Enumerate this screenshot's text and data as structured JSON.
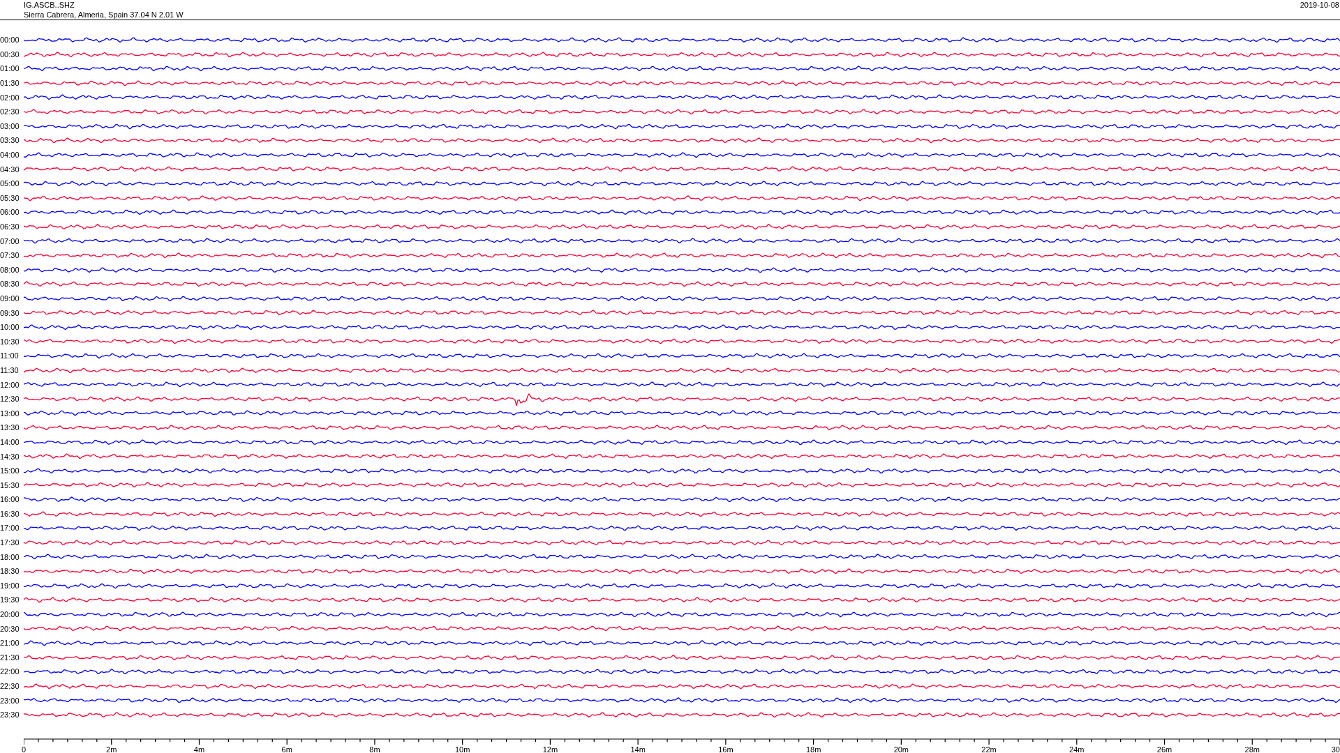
{
  "header": {
    "station": "IG.ASCB..SHZ",
    "location": "Sierra Cabrera, Almeria, Spain  37.04 N 2.01 W",
    "date": "2019-10-08"
  },
  "traces": [
    {
      "label": "00:00",
      "color": "#0000ff"
    },
    {
      "label": "00:30",
      "color": "#ff0033"
    },
    {
      "label": "01:00",
      "color": "#0000ff"
    },
    {
      "label": "01:30",
      "color": "#ff0033"
    },
    {
      "label": "02:00",
      "color": "#0000ff"
    },
    {
      "label": "02:30",
      "color": "#ff0033"
    },
    {
      "label": "03:00",
      "color": "#0000ff"
    },
    {
      "label": "03:30",
      "color": "#ff0033"
    },
    {
      "label": "04:00",
      "color": "#0000ff"
    },
    {
      "label": "04:30",
      "color": "#ff0033"
    },
    {
      "label": "05:00",
      "color": "#0000ff"
    },
    {
      "label": "05:30",
      "color": "#ff0033"
    },
    {
      "label": "06:00",
      "color": "#0000ff"
    },
    {
      "label": "06:30",
      "color": "#ff0033"
    },
    {
      "label": "07:00",
      "color": "#0000ff"
    },
    {
      "label": "07:30",
      "color": "#ff0033"
    },
    {
      "label": "08:00",
      "color": "#0000ff"
    },
    {
      "label": "08:30",
      "color": "#ff0033"
    },
    {
      "label": "09:00",
      "color": "#0000ff"
    },
    {
      "label": "09:30",
      "color": "#ff0033"
    },
    {
      "label": "10:00",
      "color": "#0000ff"
    },
    {
      "label": "10:30",
      "color": "#ff0033"
    },
    {
      "label": "11:00",
      "color": "#0000ff"
    },
    {
      "label": "11:30",
      "color": "#ff0033"
    },
    {
      "label": "12:00",
      "color": "#0000ff"
    },
    {
      "label": "12:30",
      "color": "#ff0033"
    },
    {
      "label": "13:00",
      "color": "#0000ff"
    },
    {
      "label": "13:30",
      "color": "#ff0033"
    },
    {
      "label": "14:00",
      "color": "#0000ff"
    },
    {
      "label": "14:30",
      "color": "#ff0033"
    },
    {
      "label": "15:00",
      "color": "#0000ff"
    },
    {
      "label": "15:30",
      "color": "#ff0033"
    },
    {
      "label": "16:00",
      "color": "#0000ff"
    },
    {
      "label": "16:30",
      "color": "#ff0033"
    },
    {
      "label": "17:00",
      "color": "#0000ff"
    },
    {
      "label": "17:30",
      "color": "#ff0033"
    },
    {
      "label": "18:00",
      "color": "#0000ff"
    },
    {
      "label": "18:30",
      "color": "#ff0033"
    },
    {
      "label": "19:00",
      "color": "#0000ff"
    },
    {
      "label": "19:30",
      "color": "#ff0033"
    },
    {
      "label": "20:00",
      "color": "#0000ff"
    },
    {
      "label": "20:30",
      "color": "#ff0033"
    },
    {
      "label": "21:00",
      "color": "#0000ff"
    },
    {
      "label": "21:30",
      "color": "#ff0033"
    },
    {
      "label": "22:00",
      "color": "#0000ff"
    },
    {
      "label": "22:30",
      "color": "#ff0033"
    },
    {
      "label": "23:00",
      "color": "#0000ff"
    },
    {
      "label": "23:30",
      "color": "#ff0033"
    }
  ],
  "time_axis": {
    "labels": [
      "0",
      "2m",
      "4m",
      "6m",
      "8m",
      "10m",
      "12m",
      "14m",
      "16m",
      "18m",
      "20m",
      "22m",
      "24m",
      "26m",
      "28m",
      "30"
    ]
  }
}
